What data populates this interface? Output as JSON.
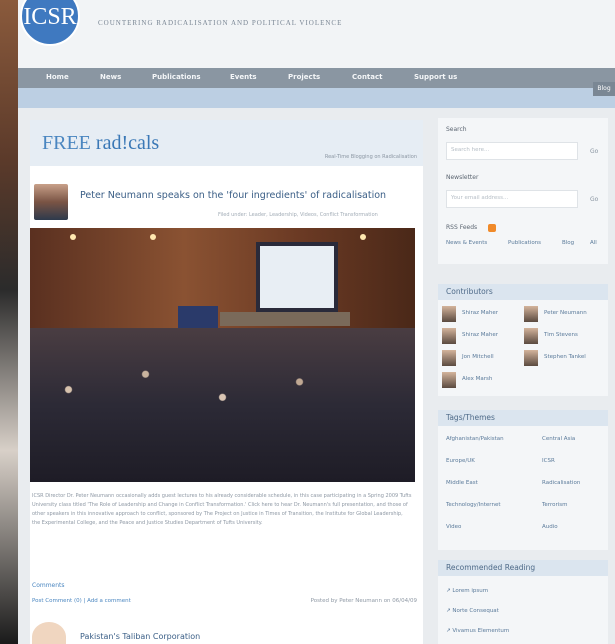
{
  "site": {
    "logo_text": "ICSR",
    "tagline": "COUNTERING RADICALISATION AND POLITICAL VIOLENCE",
    "nav": [
      "Home",
      "News",
      "Publications",
      "Events",
      "Projects",
      "Contact",
      "Support us"
    ],
    "nav_end": "Blog"
  },
  "blog": {
    "name_part1": "FREE ",
    "name_part2": "rad!cals",
    "subtitle": "Real-Time Blogging on Radicalisation"
  },
  "post": {
    "title": "Peter Neumann speaks on the 'four ingredients' of radicalisation",
    "meta": "Filed under: Leader, Leadership, Videos, Conflict Transformation",
    "body": "ICSR Director Dr. Peter Neumann occasionally adds guest lectures to his already considerable schedule, in this case participating in a Spring 2009 Tufts University class titled 'The Role of Leadership and Change in Conflict Transformation.' Click here to hear Dr. Neumann's full presentation, and those of other speakers in this innovative approach to conflict, sponsored by The Project on Justice in Times of Transition, the Institute for Global Leadership, the Experimental College, and the Peace and Justice Studies Department of Tufts University.",
    "comments_label": "Comments",
    "links": "Post Comment (0) | Add a comment",
    "posted_by": "Posted by Peter Neumann on 06/04/09"
  },
  "post2": {
    "title": "Pakistan's Taliban Corporation"
  },
  "sidebar": {
    "search_label": "Search",
    "search_placeholder": "Search here...",
    "go": "Go",
    "newsletter_label": "Newsletter",
    "newsletter_placeholder": "Your email address...",
    "rss_label": "RSS Feeds",
    "rss_links": [
      "News & Events",
      "Publications",
      "Blog",
      "All"
    ],
    "contributors_header": "Contributors",
    "contributors": [
      "Shiraz Maher",
      "Peter Neumann",
      "Shiraz Maher",
      "Tim Stevens",
      "Jon Mitchell",
      "Stephen Tankel",
      "Alex Marsh"
    ],
    "tags_header": "Tags/Themes",
    "tags": [
      "Afghanistan/Pakistan",
      "Central Asia",
      "Europe/UK",
      "ICSR",
      "Middle East",
      "Radicalisation",
      "Technology/Internet",
      "Terrorism",
      "Video",
      "Audio"
    ],
    "recommended_header": "Recommended Reading",
    "recommended": [
      "↗ Lorem ipsum",
      "↗ Norte Consequat",
      "↗ Vivamus Elementum"
    ]
  },
  "colors": {
    "accent": "#4a86c0",
    "nav": "#8a96a2",
    "band": "#bccfe3"
  }
}
